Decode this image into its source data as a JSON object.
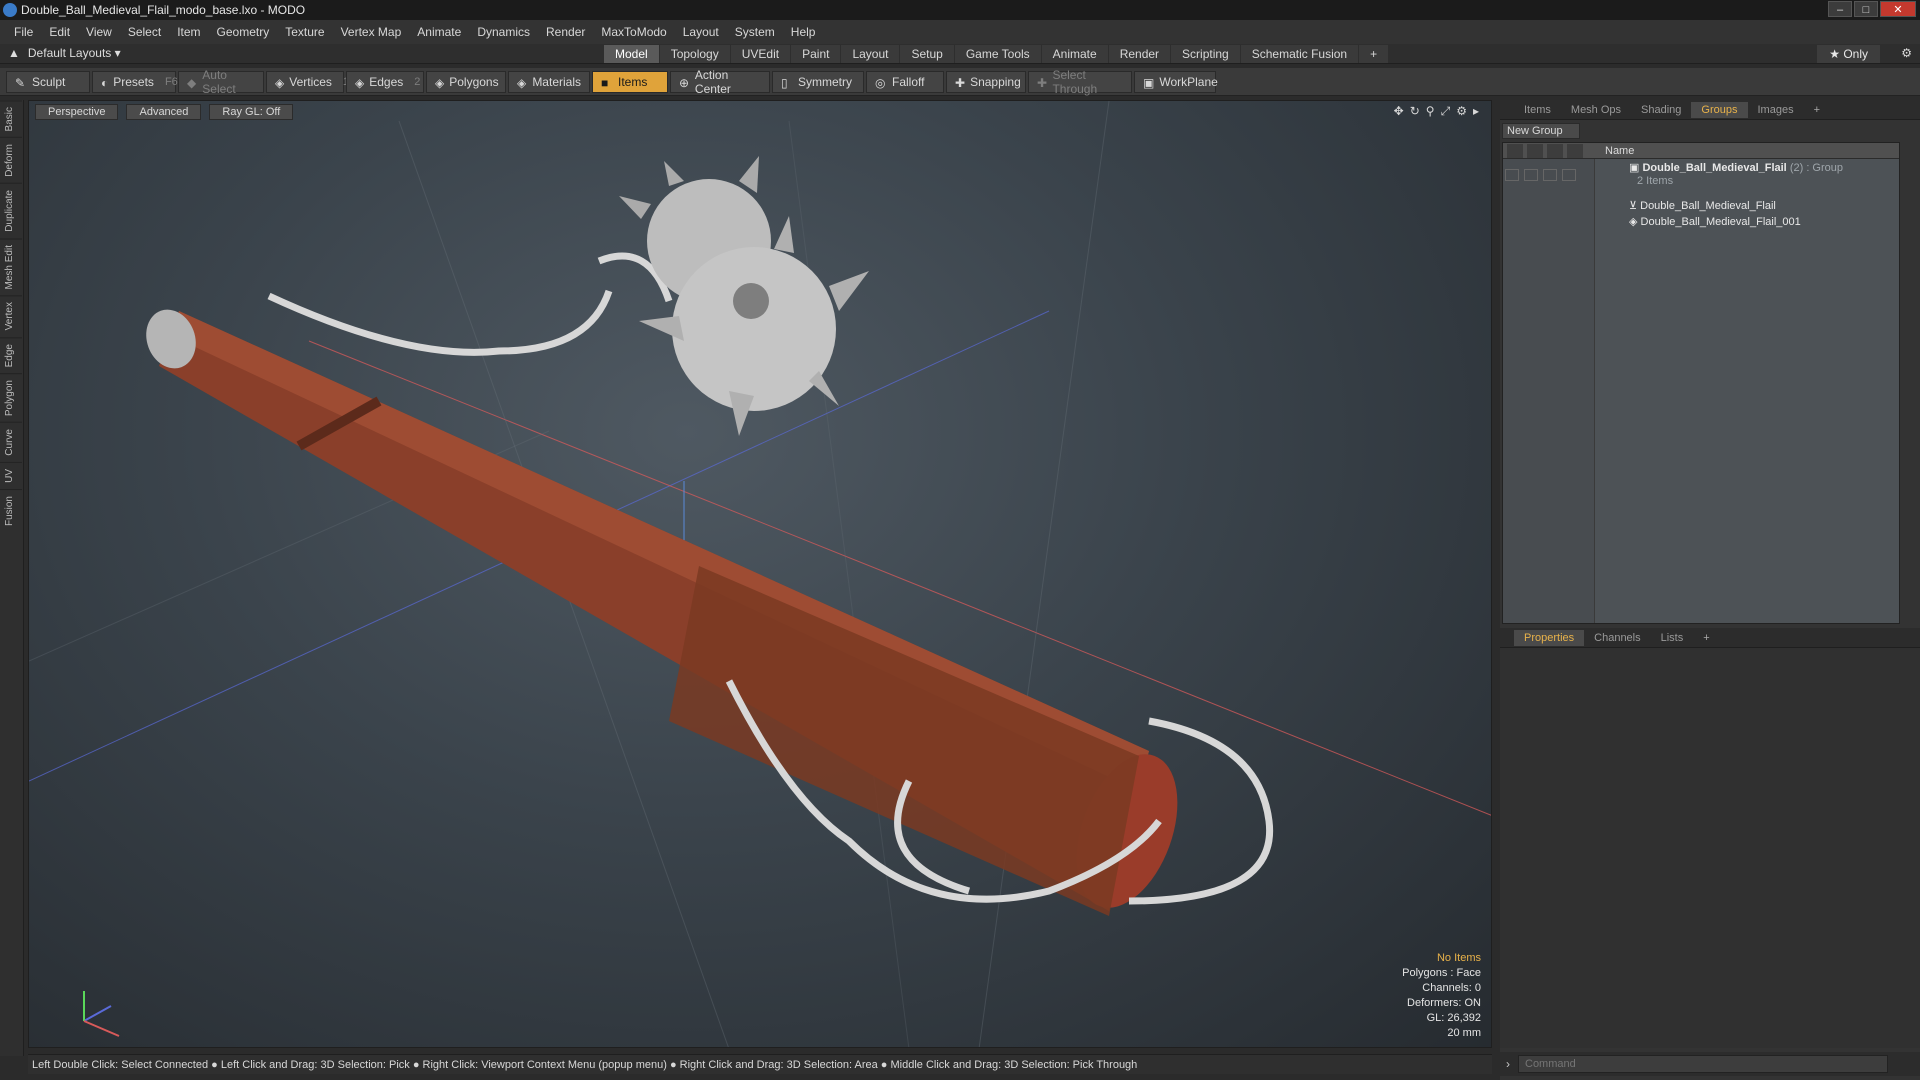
{
  "window": {
    "title": "Double_Ball_Medieval_Flail_modo_base.lxo - MODO",
    "min_label": "–",
    "max_label": "□",
    "close_label": "✕"
  },
  "menu": {
    "items": [
      "File",
      "Edit",
      "View",
      "Select",
      "Item",
      "Geometry",
      "Texture",
      "Vertex Map",
      "Animate",
      "Dynamics",
      "Render",
      "MaxToModo",
      "Layout",
      "System",
      "Help"
    ]
  },
  "layoutbar": {
    "layouts_label": "Default Layouts ▾",
    "tabs": [
      "Model",
      "Topology",
      "UVEdit",
      "Paint",
      "Layout",
      "Setup",
      "Game Tools",
      "Animate",
      "Render",
      "Scripting",
      "Schematic Fusion",
      "+"
    ],
    "active_tab": "Model",
    "only_label": "★ Only",
    "gear_label": "⚙"
  },
  "toolbar": {
    "sculpt": "Sculpt",
    "presets": "Presets",
    "presets_key": "F6",
    "auto_select": "Auto Select",
    "vertices": "Vertices",
    "vertices_key": "1",
    "edges": "Edges",
    "edges_key": "2",
    "polygons": "Polygons",
    "materials": "Materials",
    "items": "Items",
    "action_center": "Action Center",
    "symmetry": "Symmetry",
    "falloff": "Falloff",
    "snapping": "Snapping",
    "select_through": "Select Through",
    "workplane": "WorkPlane"
  },
  "left_tabs": [
    "Basic",
    "Deform",
    "Duplicate",
    "Mesh Edit",
    "Vertex",
    "Edge",
    "Polygon",
    "Curve",
    "UV",
    "Fusion"
  ],
  "viewport": {
    "perspective": "Perspective",
    "advanced": "Advanced",
    "raygl": "Ray GL: Off",
    "info": {
      "no_items": "No Items",
      "polygons": "Polygons : Face",
      "channels": "Channels: 0",
      "deformers": "Deformers: ON",
      "gl": "GL: 26,392",
      "size": "20 mm"
    }
  },
  "statusbar": {
    "text": "Left Double Click: Select Connected ● Left Click and Drag: 3D Selection: Pick ● Right Click: Viewport Context Menu (popup menu) ● Right Click and Drag: 3D Selection: Area ● Middle Click and Drag: 3D Selection: Pick Through"
  },
  "rightpanel": {
    "tabs": [
      "Items",
      "Mesh Ops",
      "Shading",
      "Groups",
      "Images",
      "+"
    ],
    "active_tab": "Groups",
    "new_group": "New Group",
    "name_header": "Name",
    "group_name": "Double_Ball_Medieval_Flail",
    "group_suffix": "(2) : Group",
    "group_count": "2 Items",
    "children": [
      "Double_Ball_Medieval_Flail",
      "Double_Ball_Medieval_Flail_001"
    ],
    "prop_tabs": [
      "Properties",
      "Channels",
      "Lists",
      "+"
    ],
    "prop_active": "Properties",
    "command_placeholder": "Command"
  },
  "colors": {
    "accent": "#e0a33a",
    "viewport_bg": "#3a434b",
    "wood": "#8a3f2a",
    "metal": "#bdbdbd"
  }
}
